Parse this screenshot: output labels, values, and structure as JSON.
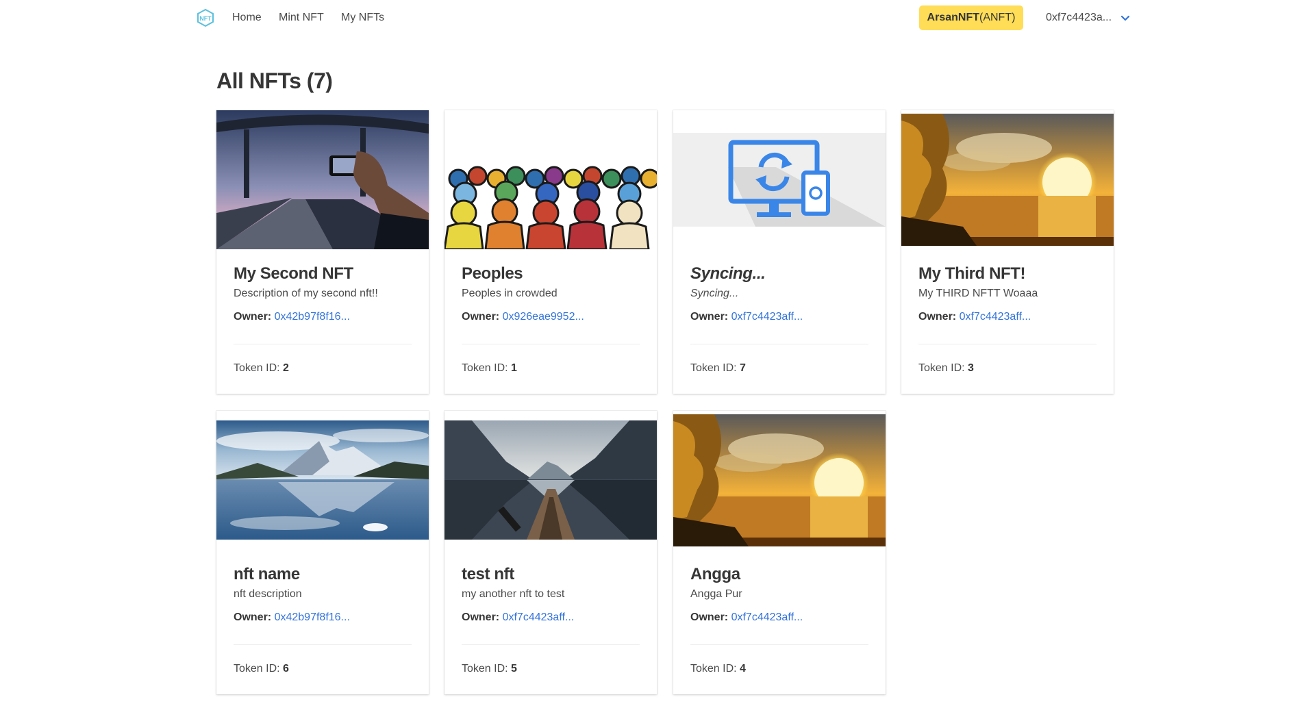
{
  "nav": {
    "home": "Home",
    "mint": "Mint NFT",
    "my_nfts": "My NFTs",
    "token_symbol_bold": "ArsanNFT",
    "token_symbol_rest": "(ANFT)",
    "account": "0xf7c4423a...",
    "accent": "#ffdd57"
  },
  "page": {
    "title": "All NFTs (7)"
  },
  "labels": {
    "owner": "Owner:",
    "token_id": "Token ID:"
  },
  "link_color": "#3273dc",
  "cards": [
    {
      "title": "My Second NFT",
      "description": "Description of my second nft!!",
      "owner": "0x42b97f8f16...",
      "token_id": "2",
      "image": "bridge-road-photo"
    },
    {
      "title": "Peoples",
      "description": "Peoples in crowded",
      "owner": "0x926eae9952...",
      "token_id": "1",
      "image": "crowd-illustration"
    },
    {
      "title": "Syncing...",
      "description": "Syncing...",
      "owner": "0xf7c4423aff...",
      "token_id": "7",
      "image": "sync-devices-icon"
    },
    {
      "title": "My Third NFT!",
      "description": "My THIRD NFTT Woaaa",
      "owner": "0xf7c4423aff...",
      "token_id": "3",
      "image": "sunset-lake-photo"
    },
    {
      "title": "nft name",
      "description": "nft description",
      "owner": "0x42b97f8f16...",
      "token_id": "6",
      "image": "snowy-mountain-lake-photo"
    },
    {
      "title": "test nft",
      "description": "my another nft to test",
      "owner": "0xf7c4423aff...",
      "token_id": "5",
      "image": "fjord-kayak-photo"
    },
    {
      "title": "Angga",
      "description": "Angga Pur",
      "owner": "0xf7c4423aff...",
      "token_id": "4",
      "image": "sunset-lake-photo"
    }
  ]
}
